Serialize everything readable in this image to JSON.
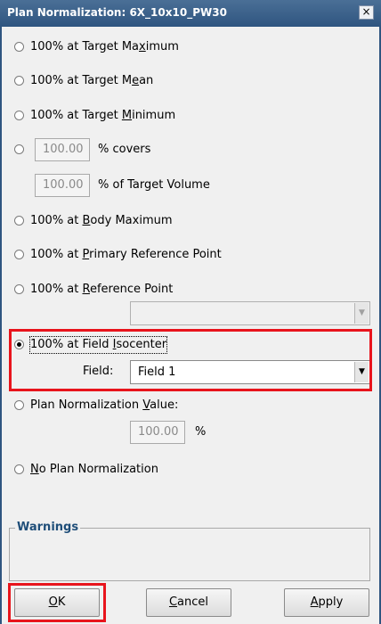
{
  "window": {
    "title": "Plan Normalization: 6X_10x10_PW30",
    "close": "×"
  },
  "options": [
    {
      "pre": "100% at Target Ma",
      "key": "x",
      "post": "imum",
      "checked": false
    },
    {
      "pre": "100% at Target M",
      "key": "e",
      "post": "an",
      "checked": false
    },
    {
      "pre": "100% at Target ",
      "key": "M",
      "post": "inimum",
      "checked": false
    },
    {
      "pre": "",
      "key": "",
      "post": "",
      "checked": false
    },
    {
      "pre": "100% at ",
      "key": "B",
      "post": "ody Maximum",
      "checked": false
    },
    {
      "pre": "100% at ",
      "key": "P",
      "post": "rimary Reference Point",
      "checked": false
    },
    {
      "pre": "100% at ",
      "key": "R",
      "post": "eference Point",
      "checked": false
    },
    {
      "pre": "100% at Field ",
      "key": "I",
      "post": "socenter",
      "checked": true
    },
    {
      "pre": "Plan Normalization ",
      "key": "V",
      "post": "alue:",
      "checked": false
    },
    {
      "pre": "",
      "key": "N",
      "post": "o Plan Normalization",
      "checked": false
    }
  ],
  "covers": {
    "value": "100.00",
    "label": "% covers",
    "target_value": "100.00",
    "target_label": "% of Target Volume"
  },
  "reference_point": {
    "value": "",
    "arrow": "▼"
  },
  "field": {
    "label": "Field:",
    "value": "Field 1",
    "arrow": "▼"
  },
  "plan_value": {
    "value": "100.00",
    "unit": "%"
  },
  "warnings": {
    "legend": "Warnings"
  },
  "buttons": {
    "ok": {
      "key": "O",
      "rest": "K"
    },
    "cancel": {
      "key": "C",
      "rest": "ancel"
    },
    "apply": {
      "key": "A",
      "rest": "pply"
    }
  },
  "accent_color": "#e8141c"
}
